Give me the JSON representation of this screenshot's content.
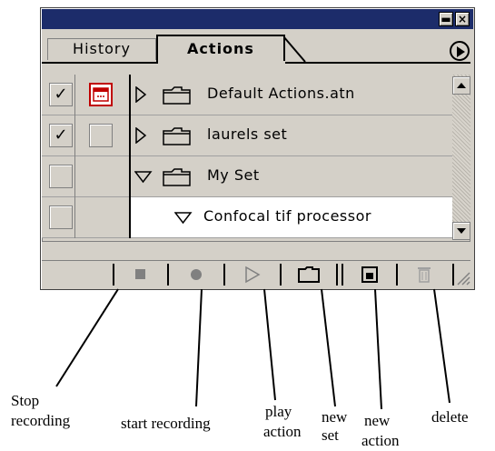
{
  "palette": {
    "tabs": [
      {
        "label": "History",
        "active": false
      },
      {
        "label": "Actions",
        "active": true
      }
    ],
    "title_buttons": {
      "minimize": "▬",
      "close": "×"
    },
    "rows": [
      {
        "label": "Default Actions.atn",
        "checked": true,
        "dialog": true,
        "expanded": false,
        "kind": "set"
      },
      {
        "label": "laurels set",
        "checked": true,
        "dialog": false,
        "expanded": false,
        "kind": "set"
      },
      {
        "label": "My Set",
        "checked": false,
        "dialog": false,
        "expanded": true,
        "kind": "set"
      },
      {
        "label": "Confocal tif processor",
        "checked": false,
        "dialog": false,
        "expanded": true,
        "kind": "action"
      }
    ],
    "toolbar_icons": [
      "stop-icon",
      "record-icon",
      "play-icon",
      "new-set-icon",
      "new-action-icon",
      "trash-icon"
    ]
  },
  "annotations": {
    "stop": "Stop\nrecording",
    "start": "start recording",
    "play": "play\naction",
    "new_set": "new\nset",
    "new_action": "new\naction",
    "delete": "delete"
  },
  "colors": {
    "title_bar": "#1c2c6a",
    "panel": "#d4d0c8",
    "dialog_toggle": "#c00000"
  }
}
